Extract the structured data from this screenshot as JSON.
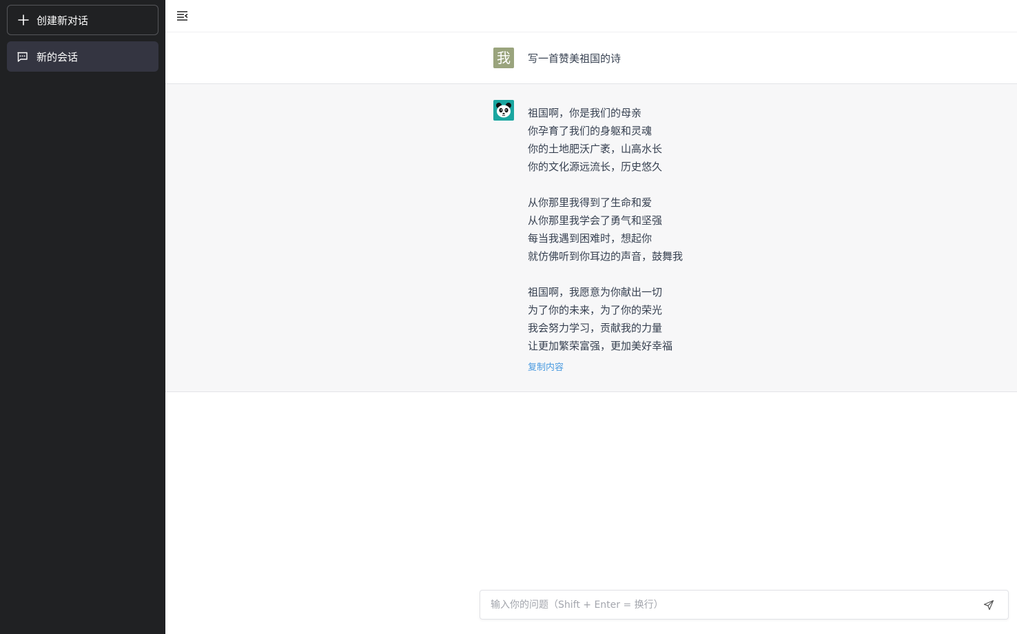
{
  "sidebar": {
    "new_chat_label": "创建新对话",
    "conversations": [
      {
        "title": "新的会话"
      }
    ]
  },
  "chat": {
    "user": {
      "avatar_text": "我",
      "message": "写一首赞美祖国的诗"
    },
    "bot": {
      "lines": [
        "祖国啊，你是我们的母亲",
        "你孕育了我们的身躯和灵魂",
        "你的土地肥沃广袤，山高水长",
        "你的文化源远流长，历史悠久",
        "",
        "从你那里我得到了生命和爱",
        "从你那里我学会了勇气和坚强",
        "每当我遇到困难时，想起你",
        "就仿佛听到你耳边的声音，鼓舞我",
        "",
        "祖国啊，我愿意为你献出一切",
        "为了你的未来，为了你的荣光",
        "我会努力学习，贡献我的力量",
        "让更加繁荣富强，更加美好幸福"
      ],
      "copy_label": "复制内容"
    }
  },
  "input": {
    "placeholder": "输入你的问题（Shift + Enter = 换行）"
  },
  "colors": {
    "sidebar_bg": "#202123",
    "active_item_bg": "#343541",
    "bot_row_bg": "#f7f7f8",
    "user_avatar_bg": "#9aa47d",
    "link": "#4a9be0"
  },
  "icons": [
    "plus-icon",
    "chat-bubble-icon",
    "menu-collapse-icon",
    "panda-avatar-icon",
    "send-icon"
  ]
}
